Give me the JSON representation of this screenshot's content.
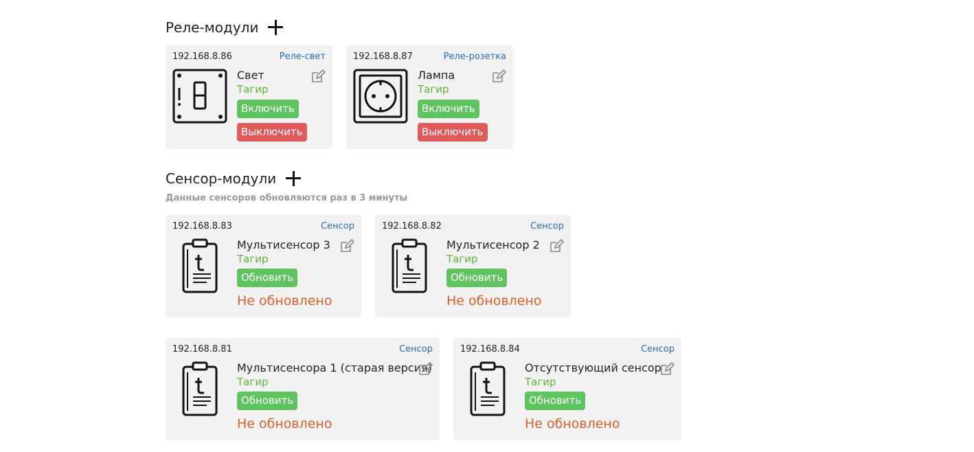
{
  "relay_section": {
    "title": "Реле-модули"
  },
  "sensor_section": {
    "title": "Сенсор-модули",
    "note": "Данные сенсоров обновляются раз в 3 минуты"
  },
  "relays": [
    {
      "ip": "192.168.8.86",
      "type": "Реле-свет",
      "name": "Свет",
      "owner": "Тагир",
      "on_label": "Включить",
      "off_label": "Выключить",
      "icon": "light-switch-icon"
    },
    {
      "ip": "192.168.8.87",
      "type": "Реле-розетка",
      "name": "Лампа",
      "owner": "Тагир",
      "on_label": "Включить",
      "off_label": "Выключить",
      "icon": "power-socket-icon"
    }
  ],
  "sensors": [
    {
      "ip": "192.168.8.83",
      "type": "Сенсор",
      "name": "Мультисенсор 3",
      "owner": "Тагир",
      "update_label": "Обновить",
      "status": "Не обновлено",
      "icon": "sensor-clipboard-icon"
    },
    {
      "ip": "192.168.8.82",
      "type": "Сенсор",
      "name": "Мультисенсор 2",
      "owner": "Тагир",
      "update_label": "Обновить",
      "status": "Не обновлено",
      "icon": "sensor-clipboard-icon"
    },
    {
      "ip": "192.168.8.81",
      "type": "Сенсор",
      "name": "Мультисенсора 1 (старая версия)",
      "owner": "Тагир",
      "update_label": "Обновить",
      "status": "Не обновлено",
      "icon": "sensor-clipboard-icon"
    },
    {
      "ip": "192.168.8.84",
      "type": "Сенсор",
      "name": "Отсутствующий сенсор",
      "owner": "Тагир",
      "update_label": "Обновить",
      "status": "Не обновлено",
      "icon": "sensor-clipboard-icon"
    }
  ]
}
